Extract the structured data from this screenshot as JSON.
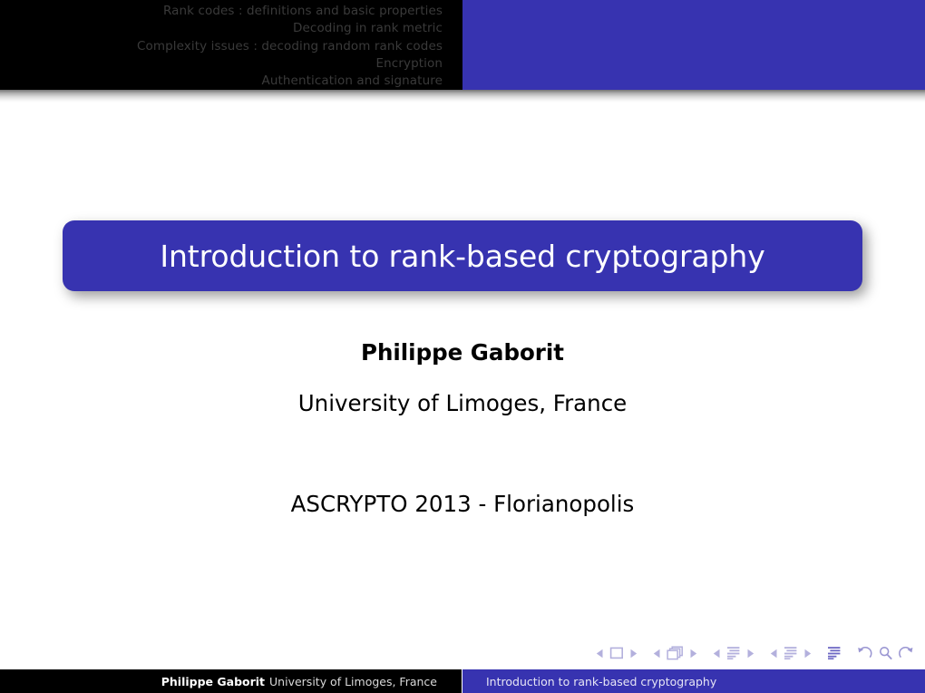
{
  "header": {
    "nav_lines": [
      "Rank codes : definitions and basic properties",
      "Decoding in rank metric",
      "Complexity issues : decoding random rank codes",
      "Encryption",
      "Authentication and signature"
    ]
  },
  "slide": {
    "title": "Introduction to rank-based cryptography",
    "author": "Philippe Gaborit",
    "affiliation": "University of Limoges, France",
    "venue": "ASCRYPTO 2013 - Florianopolis"
  },
  "navigation_symbols": [
    {
      "name": "prev-slide-icon",
      "glyph": "left-triangle"
    },
    {
      "name": "current-slide-icon",
      "glyph": "square"
    },
    {
      "name": "next-slide-icon",
      "glyph": "right-triangle"
    },
    {
      "name": "prev-frame-icon",
      "glyph": "left-triangle"
    },
    {
      "name": "current-frame-icon",
      "glyph": "stacked-frames"
    },
    {
      "name": "next-frame-icon",
      "glyph": "right-triangle"
    },
    {
      "name": "prev-subsection-icon",
      "glyph": "left-triangle"
    },
    {
      "name": "current-subsection-icon",
      "glyph": "lines-block"
    },
    {
      "name": "next-subsection-icon",
      "glyph": "right-triangle"
    },
    {
      "name": "prev-section-icon",
      "glyph": "left-triangle"
    },
    {
      "name": "current-section-icon",
      "glyph": "lines-block"
    },
    {
      "name": "next-section-icon",
      "glyph": "right-triangle"
    },
    {
      "name": "document-contents-icon",
      "glyph": "lines-block"
    },
    {
      "name": "back-icon",
      "glyph": "back-arrow"
    },
    {
      "name": "search-icon",
      "glyph": "magnifier"
    },
    {
      "name": "forward-icon",
      "glyph": "forward-arrow"
    }
  ],
  "footer": {
    "author": "Philippe Gaborit",
    "affiliation": "University of Limoges, France",
    "title": "Introduction to rank-based cryptography"
  },
  "colors": {
    "accent_blue": "#3733b0",
    "bar_black": "#000000",
    "header_text": "#3a3a3a",
    "nav_symbol": "#b3b0dd"
  }
}
